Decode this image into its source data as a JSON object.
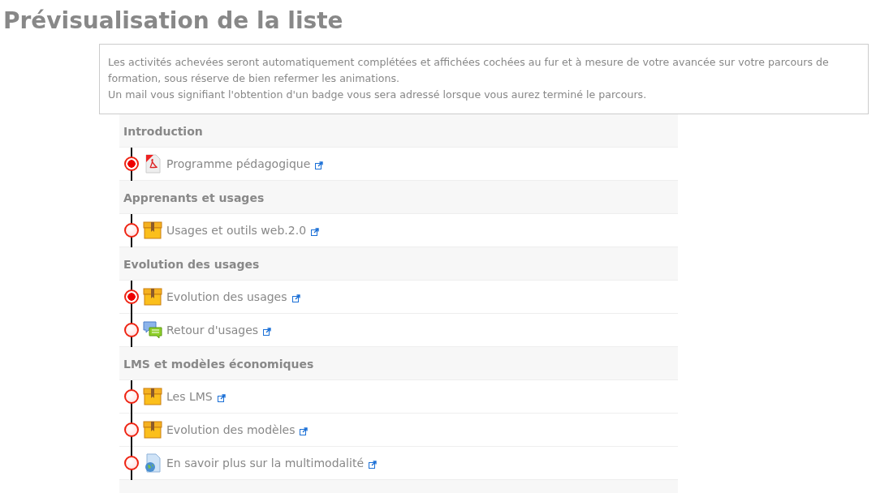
{
  "title": "Prévisualisation de la liste",
  "notice": [
    "Les activités achevées seront automatiquement complétées et affichées cochées au fur et à mesure de votre avancée sur votre parcours de formation, sous réserve de bien refermer les animations.",
    "Un mail vous signifiant l'obtention d'un badge vous sera adressé lorsque vous aurez terminé le parcours."
  ],
  "sections": [
    {
      "name": "Introduction",
      "items": [
        {
          "label": "Programme pédagogique",
          "kind": "pdf",
          "completed": true
        }
      ]
    },
    {
      "name": "Apprenants et usages",
      "items": [
        {
          "label": "Usages et outils web.2.0",
          "kind": "package",
          "completed": false
        }
      ]
    },
    {
      "name": "Evolution des usages",
      "items": [
        {
          "label": "Evolution des usages",
          "kind": "package",
          "completed": true
        },
        {
          "label": "Retour d'usages",
          "kind": "forum",
          "completed": false
        }
      ]
    },
    {
      "name": "LMS et modèles économiques",
      "items": [
        {
          "label": "Les LMS",
          "kind": "package",
          "completed": false
        },
        {
          "label": "Evolution des modèles",
          "kind": "package",
          "completed": false
        },
        {
          "label": "En savoir plus sur la multimodalité",
          "kind": "url",
          "completed": false
        }
      ]
    }
  ]
}
